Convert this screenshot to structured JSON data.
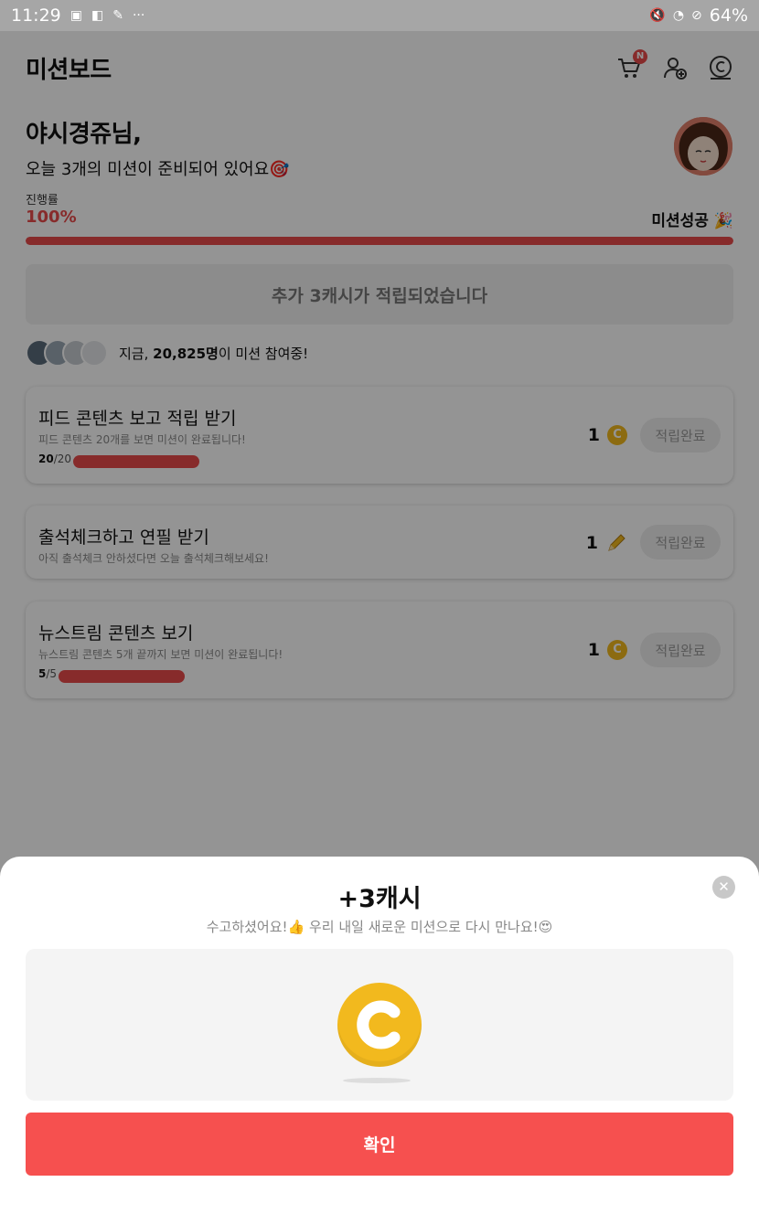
{
  "status_bar": {
    "time": "11:29",
    "battery": "64%"
  },
  "header": {
    "title": "미션보드"
  },
  "greeting": {
    "name": "야시경쥬님,",
    "subtitle": "오늘 3개의 미션이 준비되어 있어요🎯"
  },
  "progress": {
    "label": "진행률",
    "percent_text": "100%",
    "value": 1.0,
    "success_text": "미션성공 🎉"
  },
  "bonus": {
    "text": "추가 3캐시가 적립되었습니다"
  },
  "participants": {
    "prefix": "지금,",
    "count": "20,825명",
    "suffix": "이 미션 참여중!"
  },
  "missions": [
    {
      "title": "피드 콘텐츠 보고 적립 받기",
      "description": "피드 콘텐츠 20개를 보면 미션이 완료됩니다!",
      "done_count": "20",
      "total_count": "/20",
      "progress": 1.0,
      "reward": "1",
      "reward_icon": "coin-icon",
      "button": "적립완료"
    },
    {
      "title": "출석체크하고 연필 받기",
      "description": "아직 출석체크 안하셨다면 오늘 출석체크해보세요!",
      "reward": "1",
      "reward_icon": "pencil-icon",
      "button": "적립완료"
    },
    {
      "title": "뉴스트림 콘텐츠 보기",
      "description": "뉴스트림 콘텐츠 5개 끝까지 보면 미션이 완료됩니다!",
      "done_count": "5",
      "total_count": "/5",
      "progress": 1.0,
      "reward": "1",
      "reward_icon": "coin-icon",
      "button": "적립완료"
    }
  ],
  "modal": {
    "title": "+3캐시",
    "subtitle": "수고하셨어요!👍 우리 내일 새로운 미션으로 다시 만나요!😍",
    "confirm": "확인"
  },
  "colors": {
    "accent": "#e84b4b",
    "coin": "#f2b91e",
    "confirm_button": "#f6504f"
  }
}
